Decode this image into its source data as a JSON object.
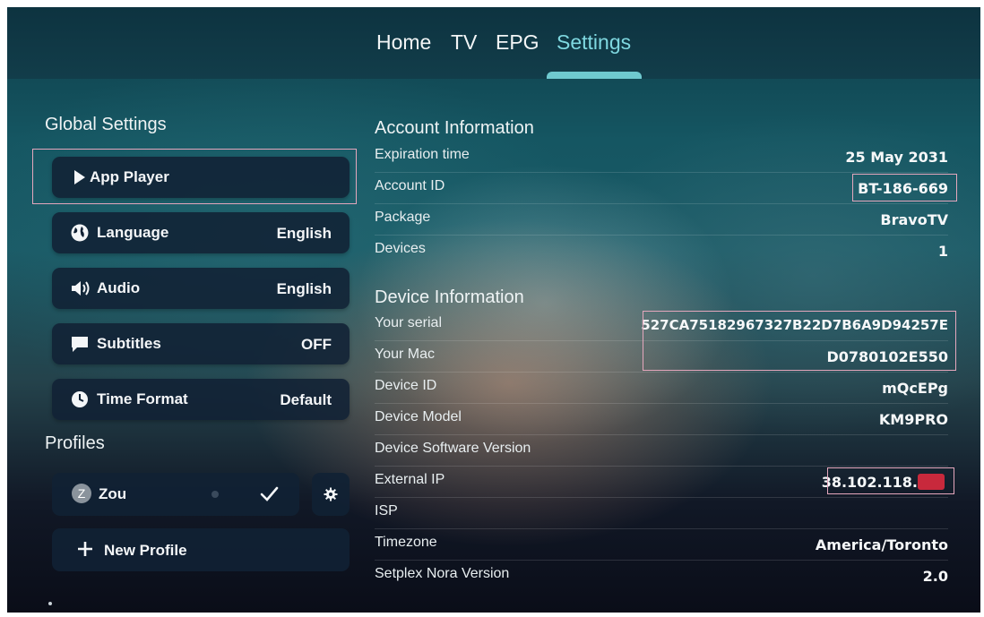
{
  "nav": {
    "tabs": [
      {
        "label": "Home"
      },
      {
        "label": "TV"
      },
      {
        "label": "EPG"
      },
      {
        "label": "Settings"
      }
    ],
    "active_tab": "Settings"
  },
  "global_settings": {
    "title": "Global Settings",
    "items": [
      {
        "icon": "play-icon",
        "label": "App Player",
        "value": ""
      },
      {
        "icon": "globe-icon",
        "label": "Language",
        "value": "English"
      },
      {
        "icon": "speaker-icon",
        "label": "Audio",
        "value": "English"
      },
      {
        "icon": "chat-bubble-icon",
        "label": "Subtitles",
        "value": "OFF"
      },
      {
        "icon": "clock-icon",
        "label": "Time Format",
        "value": "Default"
      }
    ]
  },
  "profiles": {
    "title": "Profiles",
    "current": {
      "initial": "Z",
      "name": "Zou",
      "icon": "check-icon"
    },
    "settings_icon": "gear-icon",
    "new_profile_label": "New Profile"
  },
  "account_info": {
    "title": "Account Information",
    "rows": [
      {
        "key": "Expiration time",
        "value": "25 May 2031"
      },
      {
        "key": "Account ID",
        "value": "BT-186-669"
      },
      {
        "key": "Package",
        "value": "BravoTV"
      },
      {
        "key": "Devices",
        "value": "1"
      }
    ]
  },
  "device_info": {
    "title": "Device Information",
    "rows": [
      {
        "key": "Your serial",
        "value": "527CA75182967327B22D7B6A9D94257E"
      },
      {
        "key": "Your Mac",
        "value": "D0780102E550"
      },
      {
        "key": "Device ID",
        "value": "mQcEPg"
      },
      {
        "key": "Device Model",
        "value": "KM9PRO"
      },
      {
        "key": "Device Software Version",
        "value": ""
      },
      {
        "key": "External IP",
        "value": "38.102.118."
      },
      {
        "key": "ISP",
        "value": ""
      },
      {
        "key": "Timezone",
        "value": "America/Toronto"
      },
      {
        "key": "Setplex Nora Version",
        "value": "2.0"
      }
    ]
  },
  "colors": {
    "accent": "#7fd8e0",
    "highlight_border": "#e5a7bd",
    "card_bg": "#112134"
  }
}
